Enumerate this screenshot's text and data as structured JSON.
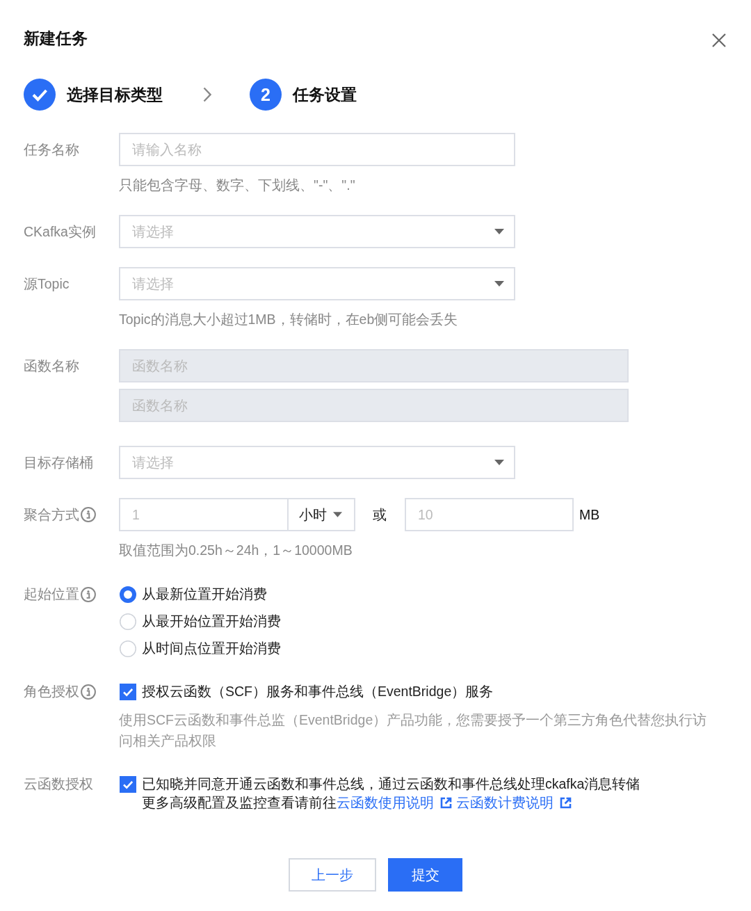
{
  "dialog": {
    "title": "新建任务"
  },
  "steps": [
    {
      "done": true,
      "label": "选择目标类型"
    },
    {
      "done": false,
      "number": "2",
      "label": "任务设置"
    }
  ],
  "fields": [
    {
      "kind": "input",
      "label": "任务名称",
      "info": false,
      "inputs": [
        {
          "placeholder": "请输入名称",
          "disabled": false
        }
      ],
      "hint": "只能包含字母、数字、下划线、\"-\"、\".\""
    },
    {
      "kind": "select",
      "label": "CKafka实例",
      "info": false,
      "placeholder": "请选择"
    },
    {
      "kind": "select",
      "label": "源Topic",
      "info": false,
      "placeholder": "请选择",
      "hint": "Topic的消息大小超过1MB，转储时，在eb侧可能会丢失"
    },
    {
      "kind": "wide_input",
      "label": "函数名称",
      "info": false,
      "inputs": [
        {
          "placeholder": "函数名称",
          "disabled": true
        },
        {
          "placeholder": "函数名称",
          "disabled": true
        }
      ]
    },
    {
      "kind": "select",
      "label": "目标存储桶",
      "info": false,
      "placeholder": "请选择"
    },
    {
      "kind": "aggregation",
      "label": "聚合方式",
      "info": true,
      "duration": {
        "placeholder": "1"
      },
      "unit": {
        "value": "小时"
      },
      "separator": "或",
      "size": {
        "placeholder": "10"
      },
      "size_unit": "MB",
      "hint": "取值范围为0.25h～24h，1～10000MB"
    },
    {
      "kind": "radio",
      "label": "起始位置",
      "info": true,
      "options": [
        {
          "label": "从最新位置开始消费",
          "selected": true
        },
        {
          "label": "从最开始位置开始消费",
          "selected": false
        },
        {
          "label": "从时间点位置开始消费",
          "selected": false
        }
      ]
    },
    {
      "kind": "checkbox",
      "label": "角色授权",
      "info": true,
      "checked": true,
      "text": "授权云函数（SCF）服务和事件总线（EventBridge）服务",
      "description": "使用SCF云函数和事件总监（EventBridge）产品功能，您需要授予一个第三方角色代替您执行访问相关产品权限"
    },
    {
      "kind": "checkbox",
      "label": "云函数授权",
      "info": false,
      "checked": true,
      "text": "已知晓并同意开通云函数和事件总线，通过云函数和事件总线处理ckafka消息转储",
      "note": "更多高级配置及监控查看请前往",
      "links": [
        {
          "text": "云函数使用说明"
        },
        {
          "text": "云函数计费说明"
        }
      ]
    }
  ],
  "buttons": [
    {
      "kind": "secondary",
      "label": "上一步"
    },
    {
      "kind": "primary",
      "label": "提交"
    }
  ]
}
